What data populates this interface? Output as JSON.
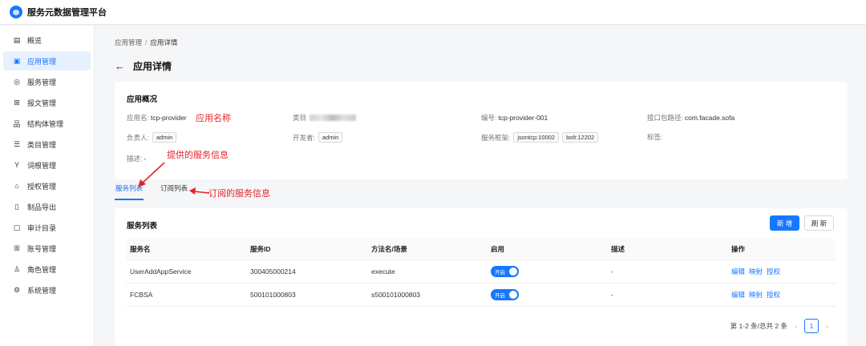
{
  "app": {
    "title": "服务元数据管理平台"
  },
  "sidebar": {
    "items": [
      {
        "label": "概览",
        "icon": "dashboard-icon",
        "glyph": "▤"
      },
      {
        "label": "应用管理",
        "icon": "app-icon",
        "glyph": "▣",
        "active": true
      },
      {
        "label": "服务管理",
        "icon": "service-icon",
        "glyph": "◎"
      },
      {
        "label": "报文管理",
        "icon": "message-icon",
        "glyph": "⊞"
      },
      {
        "label": "结构体管理",
        "icon": "structure-icon",
        "glyph": "品"
      },
      {
        "label": "类目管理",
        "icon": "category-icon",
        "glyph": "☰"
      },
      {
        "label": "词根管理",
        "icon": "root-icon",
        "glyph": "Y"
      },
      {
        "label": "授权管理",
        "icon": "auth-icon",
        "glyph": "⌂"
      },
      {
        "label": "制品导出",
        "icon": "export-icon",
        "glyph": "▯"
      },
      {
        "label": "审计目录",
        "icon": "audit-icon",
        "glyph": "▢"
      },
      {
        "label": "账号管理",
        "icon": "account-icon",
        "glyph": "ꕥ"
      },
      {
        "label": "角色管理",
        "icon": "role-icon",
        "glyph": "♙"
      },
      {
        "label": "系统管理",
        "icon": "settings-icon",
        "glyph": "⚙"
      }
    ]
  },
  "breadcrumb": {
    "parent": "应用管理",
    "sep": "/",
    "current": "应用详情"
  },
  "page": {
    "title": "应用详情",
    "back_glyph": "←"
  },
  "overview": {
    "title": "应用概况",
    "app_name_label": "应用名:",
    "app_name": "tcp-provider",
    "category_label": "类目",
    "code_label": "编号:",
    "code": "tcp-provider-001",
    "package_label": "接口包路径:",
    "package": "com.facade.sofa",
    "owner_label": "负责人:",
    "owner": "admin",
    "developer_label": "开发者:",
    "developer": "admin",
    "framework_label": "服务框架:",
    "frameworks": [
      "jsontcp:10002",
      "bolt:12202"
    ],
    "tags_label": "标签:",
    "desc_label": "描述:",
    "desc": "-"
  },
  "annotations": {
    "app_name": "应用名称",
    "provided": "提供的服务信息",
    "subscribed": "订阅的服务信息"
  },
  "tabs": [
    {
      "label": "服务列表",
      "active": true
    },
    {
      "label": "订阅列表",
      "active": false
    }
  ],
  "services": {
    "title": "服务列表",
    "new_label": "新 增",
    "refresh_label": "刷 新",
    "columns": [
      "服务名",
      "服务ID",
      "方法名/场景",
      "启用",
      "描述",
      "操作"
    ],
    "rows": [
      {
        "name": "UserAddAppService",
        "id": "300405000214",
        "method": "execute",
        "enabled_label": "开启",
        "desc": "-"
      },
      {
        "name": "FCBSA",
        "id": "500101000803",
        "method": "s500101000803",
        "enabled_label": "开启",
        "desc": "-"
      }
    ],
    "actions": [
      "编辑",
      "映射",
      "授权"
    ],
    "pager": {
      "summary": "第 1-2 条/总共 2 条",
      "prev": "‹",
      "next": "›",
      "current": "1"
    }
  },
  "colors": {
    "accent": "#1677ff",
    "annotation": "#e5232a"
  }
}
